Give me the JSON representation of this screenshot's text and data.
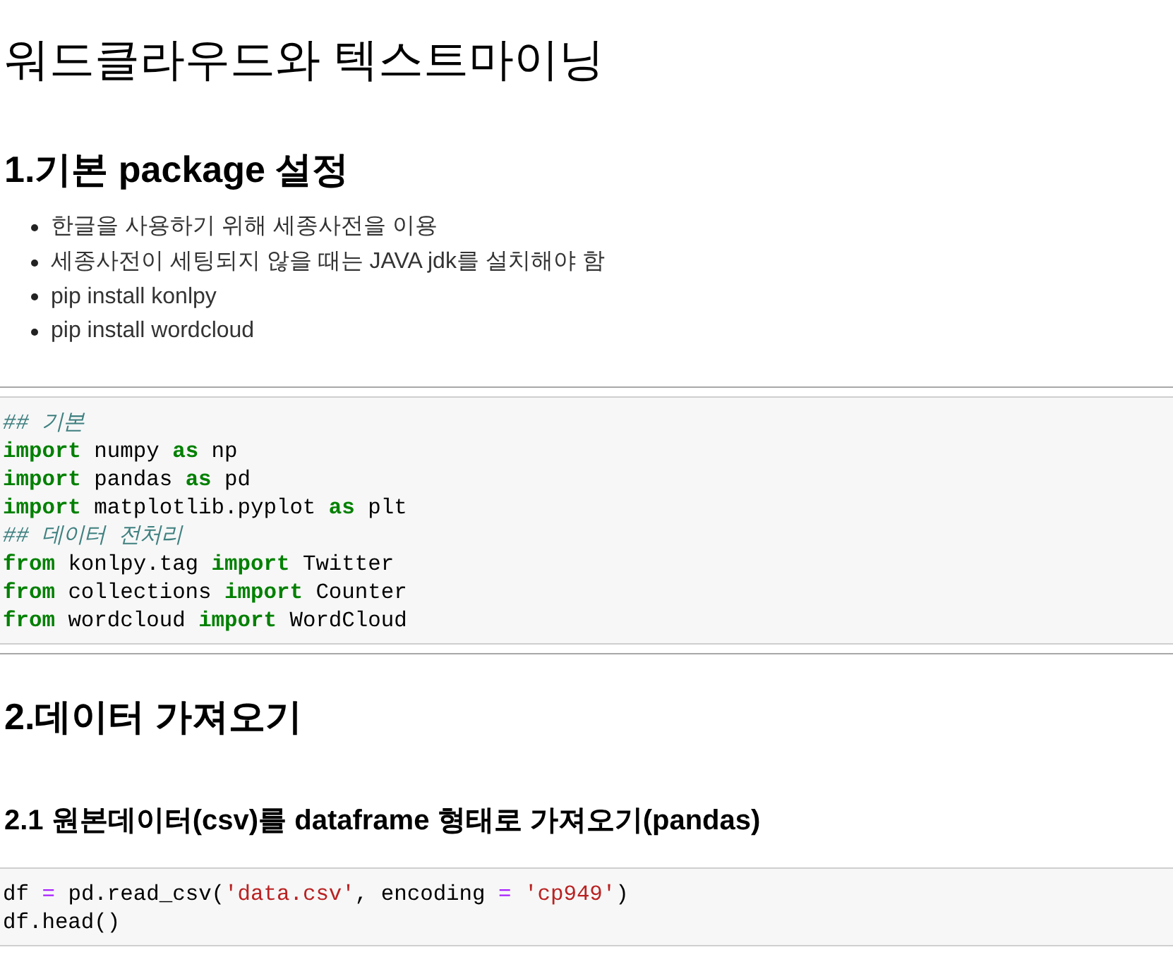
{
  "blocks": [
    {
      "kind": "heading1",
      "text": "워드클라우드와 텍스트마이닝"
    },
    {
      "kind": "heading2",
      "text": "1.기본 package 설정"
    },
    {
      "kind": "bullets",
      "items": [
        "한글을 사용하기 위해 세종사전을 이용",
        "세종사전이 세팅되지 않을 때는 JAVA jdk를 설치해야 함",
        "pip install konlpy",
        "pip install wordcloud"
      ]
    },
    {
      "kind": "rule"
    },
    {
      "kind": "code",
      "lines": [
        [
          {
            "kind": "comment",
            "text": "## 기본"
          }
        ],
        [
          {
            "kind": "keyword",
            "text": "import"
          },
          {
            "kind": "plain",
            "text": " numpy "
          },
          {
            "kind": "keyword",
            "text": "as"
          },
          {
            "kind": "plain",
            "text": " np"
          }
        ],
        [
          {
            "kind": "keyword",
            "text": "import"
          },
          {
            "kind": "plain",
            "text": " pandas "
          },
          {
            "kind": "keyword",
            "text": "as"
          },
          {
            "kind": "plain",
            "text": " pd"
          }
        ],
        [
          {
            "kind": "keyword",
            "text": "import"
          },
          {
            "kind": "plain",
            "text": " matplotlib.pyplot "
          },
          {
            "kind": "keyword",
            "text": "as"
          },
          {
            "kind": "plain",
            "text": " plt"
          }
        ],
        [
          {
            "kind": "comment",
            "text": "## 데이터 전처리"
          }
        ],
        [
          {
            "kind": "keyword",
            "text": "from"
          },
          {
            "kind": "plain",
            "text": " konlpy.tag "
          },
          {
            "kind": "keyword",
            "text": "import"
          },
          {
            "kind": "plain",
            "text": " Twitter"
          }
        ],
        [
          {
            "kind": "keyword",
            "text": "from"
          },
          {
            "kind": "plain",
            "text": " collections "
          },
          {
            "kind": "keyword",
            "text": "import"
          },
          {
            "kind": "plain",
            "text": " Counter"
          }
        ],
        [
          {
            "kind": "keyword",
            "text": "from"
          },
          {
            "kind": "plain",
            "text": " wordcloud "
          },
          {
            "kind": "keyword",
            "text": "import"
          },
          {
            "kind": "plain",
            "text": " WordCloud"
          }
        ]
      ]
    },
    {
      "kind": "rule"
    },
    {
      "kind": "heading2",
      "text": "2.데이터 가져오기"
    },
    {
      "kind": "heading3",
      "text": "2.1 원본데이터(csv)를 dataframe 형태로 가져오기(pandas)"
    },
    {
      "kind": "code",
      "lines": [
        [
          {
            "kind": "plain",
            "text": "df "
          },
          {
            "kind": "operator",
            "text": "="
          },
          {
            "kind": "plain",
            "text": " pd.read_csv("
          },
          {
            "kind": "string",
            "text": "'data.csv'"
          },
          {
            "kind": "plain",
            "text": ", encoding "
          },
          {
            "kind": "operator",
            "text": "= "
          },
          {
            "kind": "string",
            "text": "'cp949'"
          },
          {
            "kind": "plain",
            "text": ")"
          }
        ],
        [
          {
            "kind": "plain",
            "text": "df.head()"
          }
        ]
      ]
    }
  ]
}
